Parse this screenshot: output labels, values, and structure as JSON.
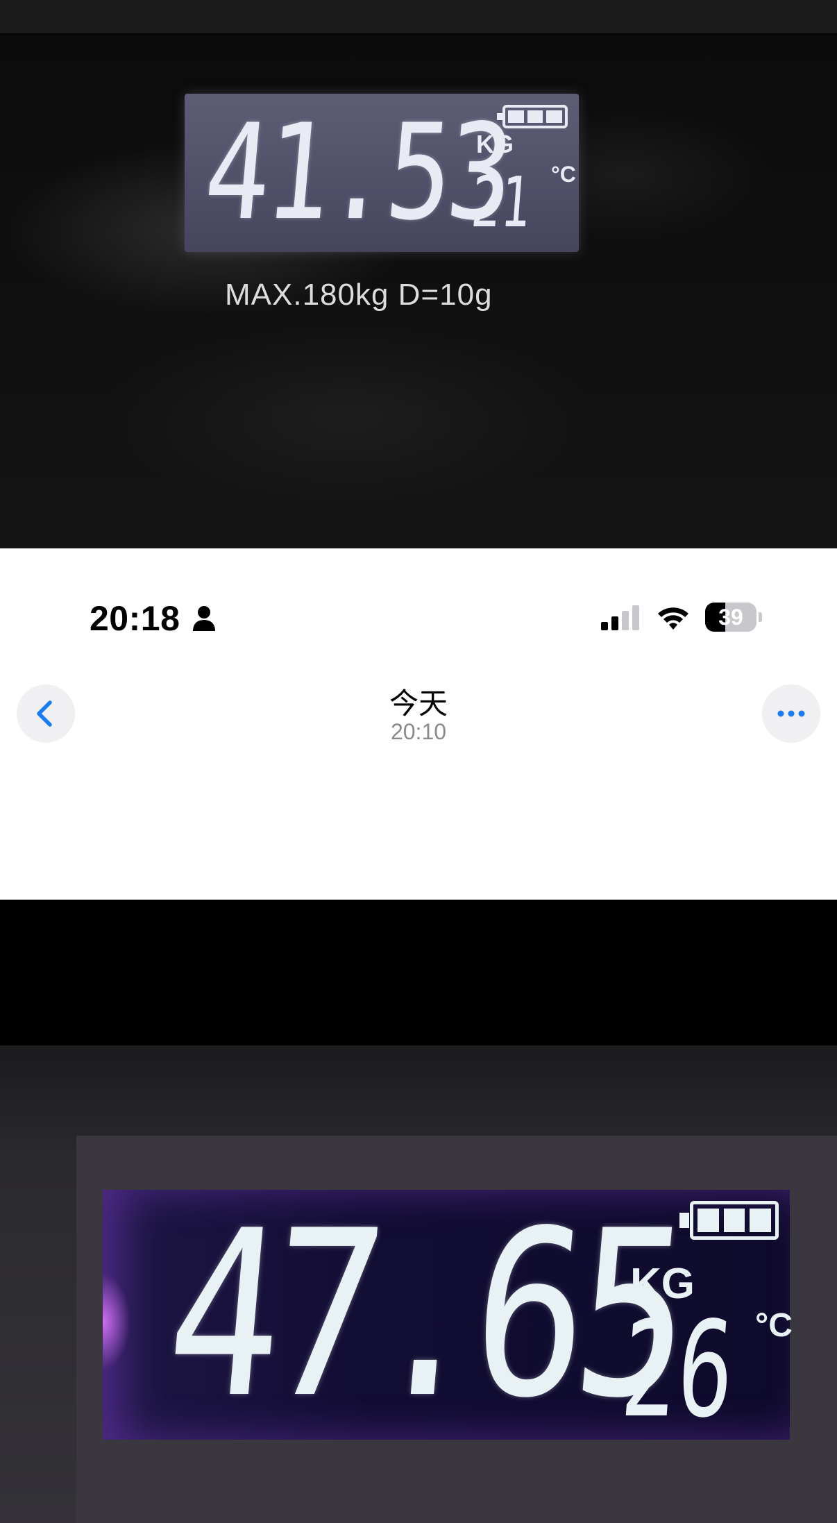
{
  "top_photo": {
    "reading": "41.53",
    "unit": "KG",
    "temperature": "21",
    "temperature_unit": "°C",
    "battery_bars": 3,
    "spec_text": "MAX.180kg D=10g"
  },
  "status_bar": {
    "time": "20:18",
    "battery_percent": "39",
    "battery_level": 0.39,
    "icons": [
      "person-icon",
      "cellular-signal-icon",
      "wifi-icon",
      "battery-icon"
    ]
  },
  "nav": {
    "title": "今天",
    "subtitle": "20:10",
    "back_icon": "chevron-left-icon",
    "more_icon": "ellipsis-icon",
    "accent_color": "#1a7cf5"
  },
  "bottom_photo": {
    "reading": "47.65",
    "unit": "KG",
    "temperature": "26",
    "temperature_unit": "°C",
    "battery_bars": 3
  }
}
